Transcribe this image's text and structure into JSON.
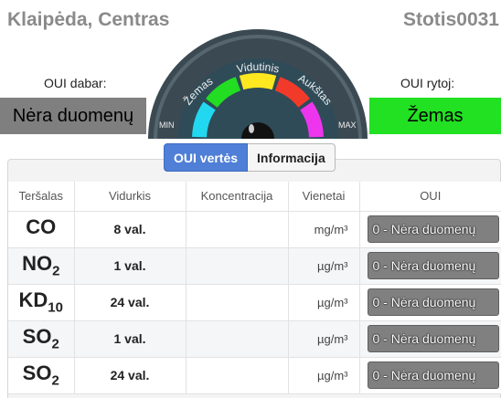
{
  "header": {
    "location": "Klaipėda, Centras",
    "station": "Stotis0031",
    "oui_now_label": "OUI dabar:",
    "oui_now_value": "Nėra duomenų",
    "oui_tomorrow_label": "OUI rytoj:",
    "oui_tomorrow_value": "Žemas"
  },
  "gauge": {
    "labels": [
      "Žemas",
      "Vidutinis",
      "Aukštas"
    ],
    "min_label": "MIN",
    "max_label": "MAX",
    "segment_colors": [
      "#22d8f0",
      "#22dd22",
      "#ffe81f",
      "#f23a2a",
      "#ee35ee"
    ]
  },
  "tabs": [
    {
      "label": "OUI vertės",
      "active": true
    },
    {
      "label": "Informacija",
      "active": false
    }
  ],
  "table": {
    "headers": [
      "Teršalas",
      "Vidurkis",
      "Koncentracija",
      "Vienetai",
      "OUI"
    ],
    "rows": [
      {
        "pollutant": "CO",
        "sub": "",
        "average": "8 val.",
        "concentration": "",
        "unit": "mg/m³",
        "oui": "0 - Nėra duomenų"
      },
      {
        "pollutant": "NO",
        "sub": "2",
        "average": "1 val.",
        "concentration": "",
        "unit": "µg/m³",
        "oui": "0 - Nėra duomenų"
      },
      {
        "pollutant": "KD",
        "sub": "10",
        "average": "24 val.",
        "concentration": "",
        "unit": "µg/m³",
        "oui": "0 - Nėra duomenų"
      },
      {
        "pollutant": "SO",
        "sub": "2",
        "average": "1 val.",
        "concentration": "",
        "unit": "µg/m³",
        "oui": "0 - Nėra duomenų"
      },
      {
        "pollutant": "SO",
        "sub": "2",
        "average": "24 val.",
        "concentration": "",
        "unit": "µg/m³",
        "oui": "0 - Nėra duomenų"
      }
    ]
  }
}
